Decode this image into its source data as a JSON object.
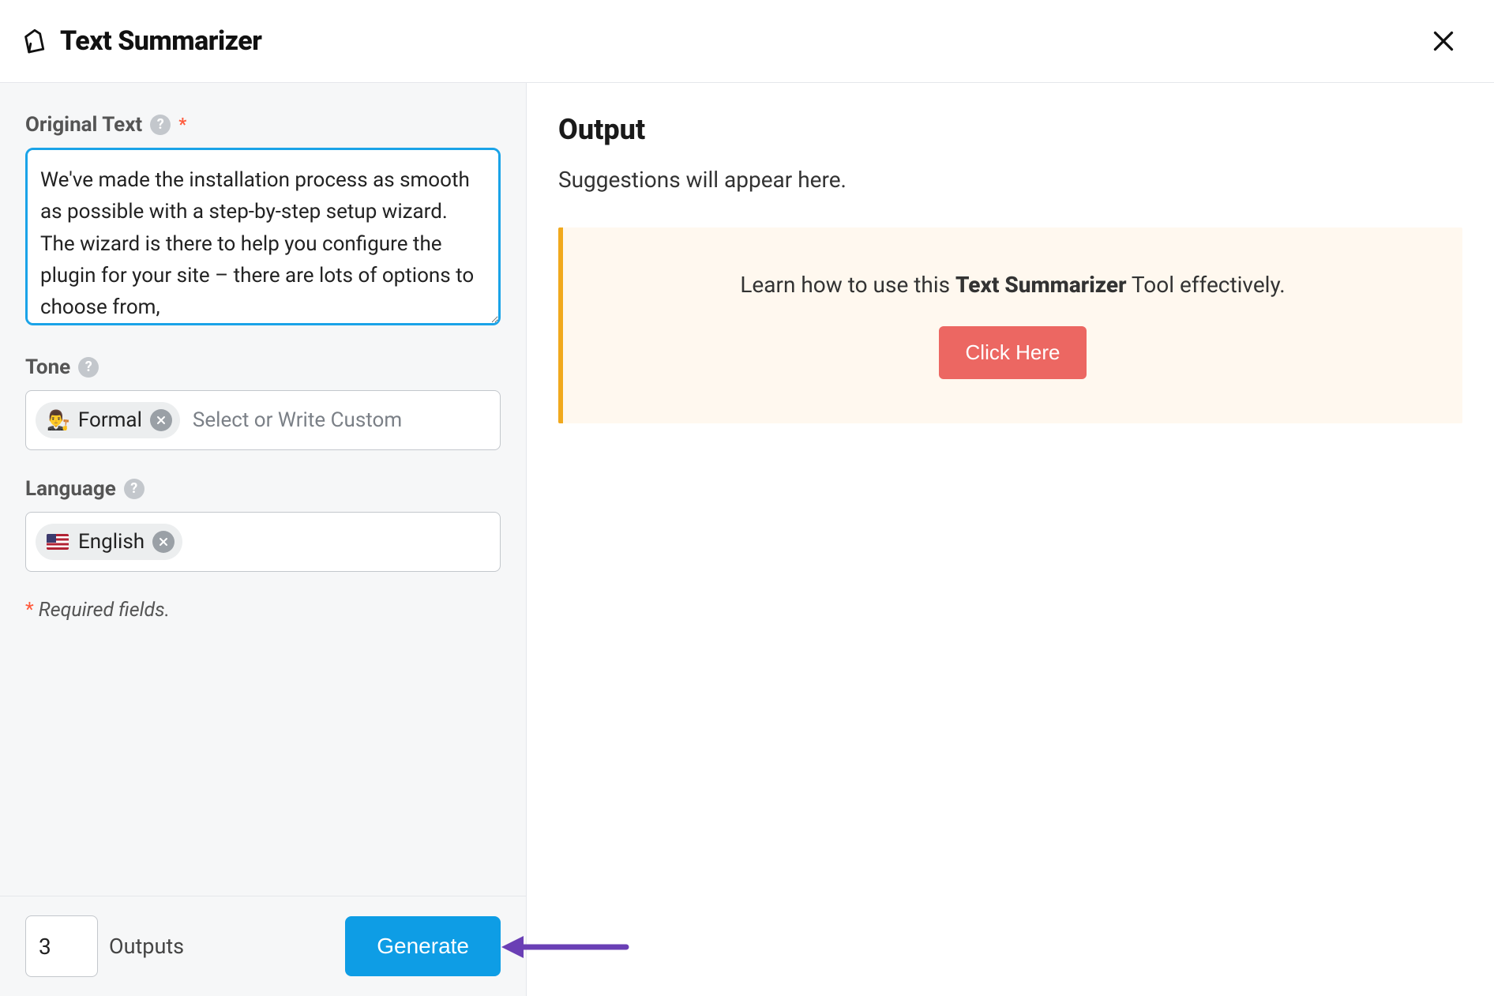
{
  "header": {
    "title": "Text Summarizer"
  },
  "form": {
    "original_text": {
      "label": "Original Text",
      "value": "We've made the installation process as smooth as possible with a step-by-step setup wizard. The wizard is there to help you configure the plugin for your site – there are lots of options to choose from,"
    },
    "tone": {
      "label": "Tone",
      "chip_emoji": "👨‍⚖️",
      "chip_label": "Formal",
      "placeholder": "Select or Write Custom"
    },
    "language": {
      "label": "Language",
      "chip_label": "English"
    },
    "required_note": "Required fields."
  },
  "footer": {
    "outputs_value": "3",
    "outputs_label": "Outputs",
    "generate_label": "Generate"
  },
  "output": {
    "title": "Output",
    "placeholder": "Suggestions will appear here.",
    "learn_prefix": "Learn how to use this ",
    "learn_bold": "Text Summarizer",
    "learn_suffix": " Tool effectively.",
    "click_here": "Click Here"
  }
}
